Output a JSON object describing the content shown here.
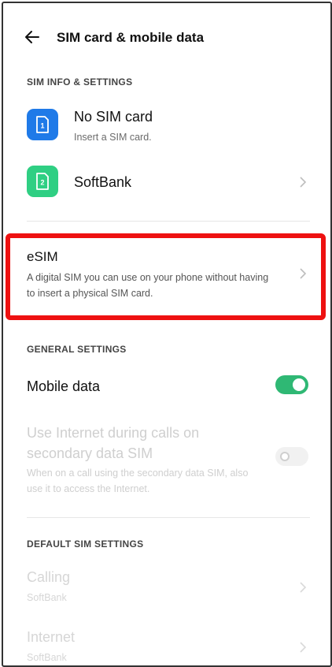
{
  "header": {
    "title": "SIM card & mobile data"
  },
  "sim_info": {
    "section_title": "SIM INFO & SETTINGS",
    "sim1": {
      "title": "No SIM card",
      "subtitle": "Insert a SIM card.",
      "badge": "1",
      "color": "#1f7ae8"
    },
    "sim2": {
      "title": "SoftBank",
      "badge": "2",
      "color": "#2fcf83"
    },
    "esim": {
      "title": "eSIM",
      "subtitle": "A digital SIM you can use on your phone without having to insert a physical SIM card."
    }
  },
  "general": {
    "section_title": "GENERAL SETTINGS",
    "mobile_data": {
      "title": "Mobile data",
      "enabled": true
    },
    "internet_calls": {
      "title": "Use Internet during calls on secondary data SIM",
      "subtitle": "When on a call using the secondary data SIM, also use it to access the Internet.",
      "enabled": false
    }
  },
  "default_sim": {
    "section_title": "DEFAULT SIM SETTINGS",
    "calling": {
      "title": "Calling",
      "value": "SoftBank"
    },
    "internet": {
      "title": "Internet",
      "value": "SoftBank"
    }
  },
  "colors": {
    "accent_green": "#2fb874",
    "highlight_red": "#ee1111",
    "sim1_blue": "#1f7ae8",
    "sim2_green": "#2fcf83"
  }
}
